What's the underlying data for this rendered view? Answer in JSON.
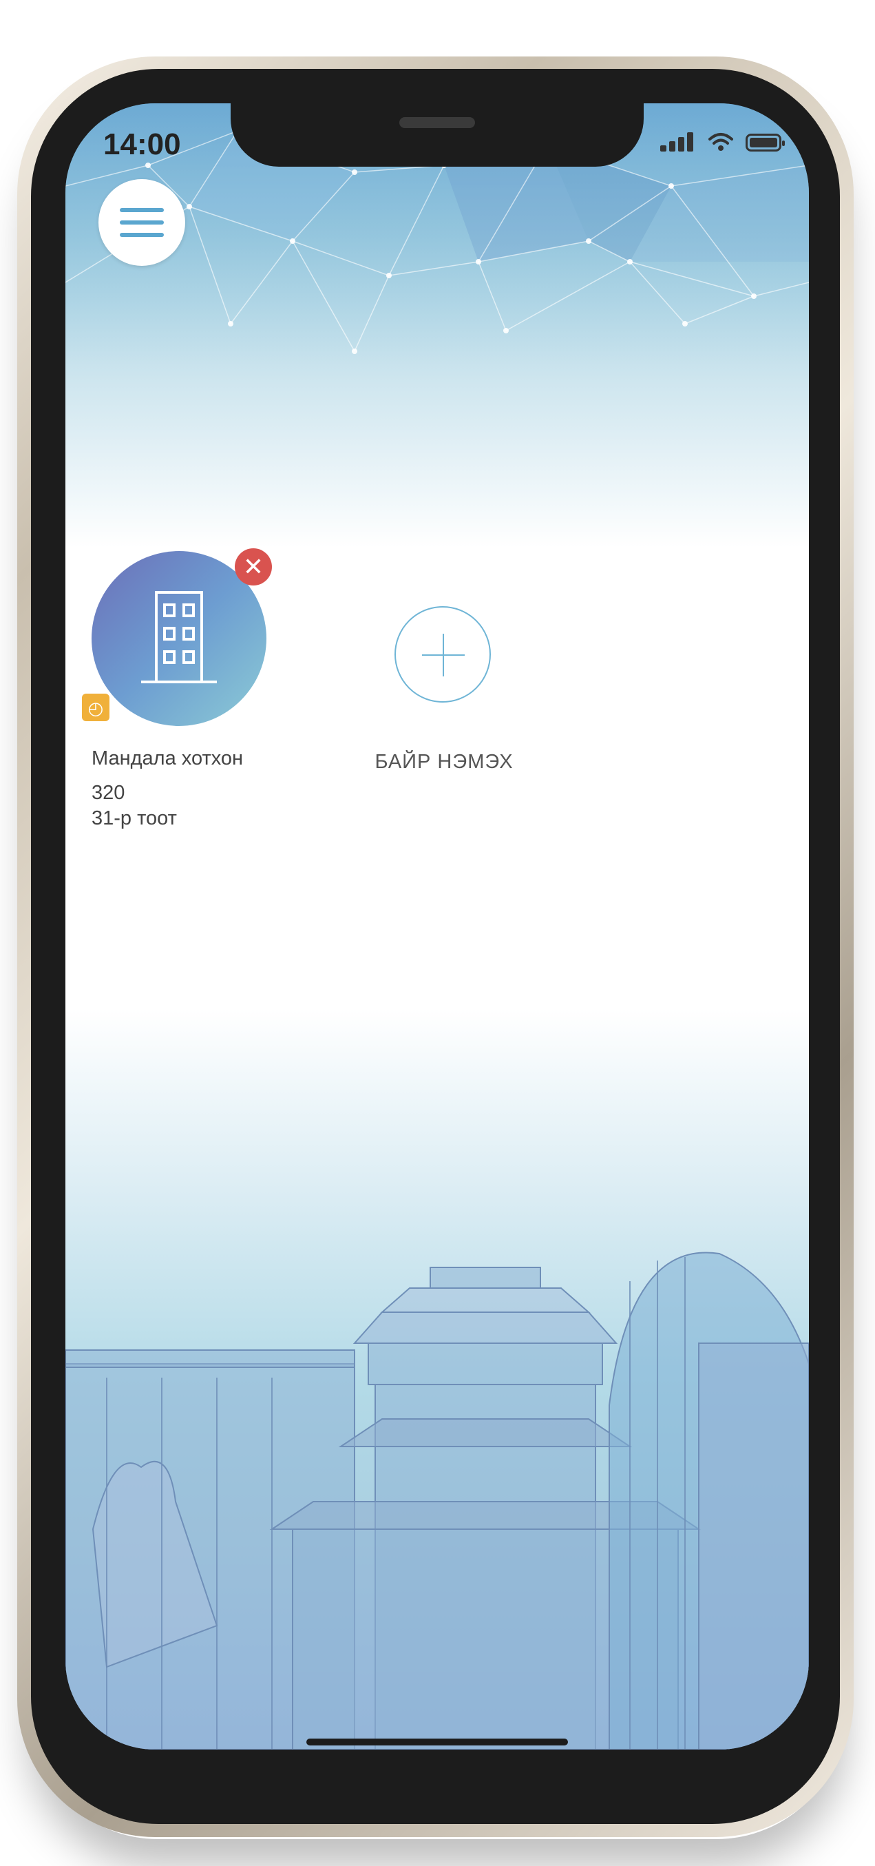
{
  "status_bar": {
    "time": "14:00",
    "signal_icon": "cellular-signal-icon",
    "wifi_icon": "wifi-icon",
    "battery_icon": "battery-icon"
  },
  "header": {
    "menu_icon": "hamburger-menu-icon"
  },
  "buildings": [
    {
      "name": "Мандала хотхон",
      "number": "320",
      "apartment": "31-р тоот",
      "icon": "building-icon",
      "remove_icon": "close-icon",
      "status_icon": "pending-clock-icon"
    }
  ],
  "add_building": {
    "label": "БАЙР НЭМЭХ",
    "icon": "plus-icon"
  },
  "colors": {
    "accent": "#5aa6cf",
    "remove": "#d9534f",
    "pending": "#f0b03a"
  }
}
